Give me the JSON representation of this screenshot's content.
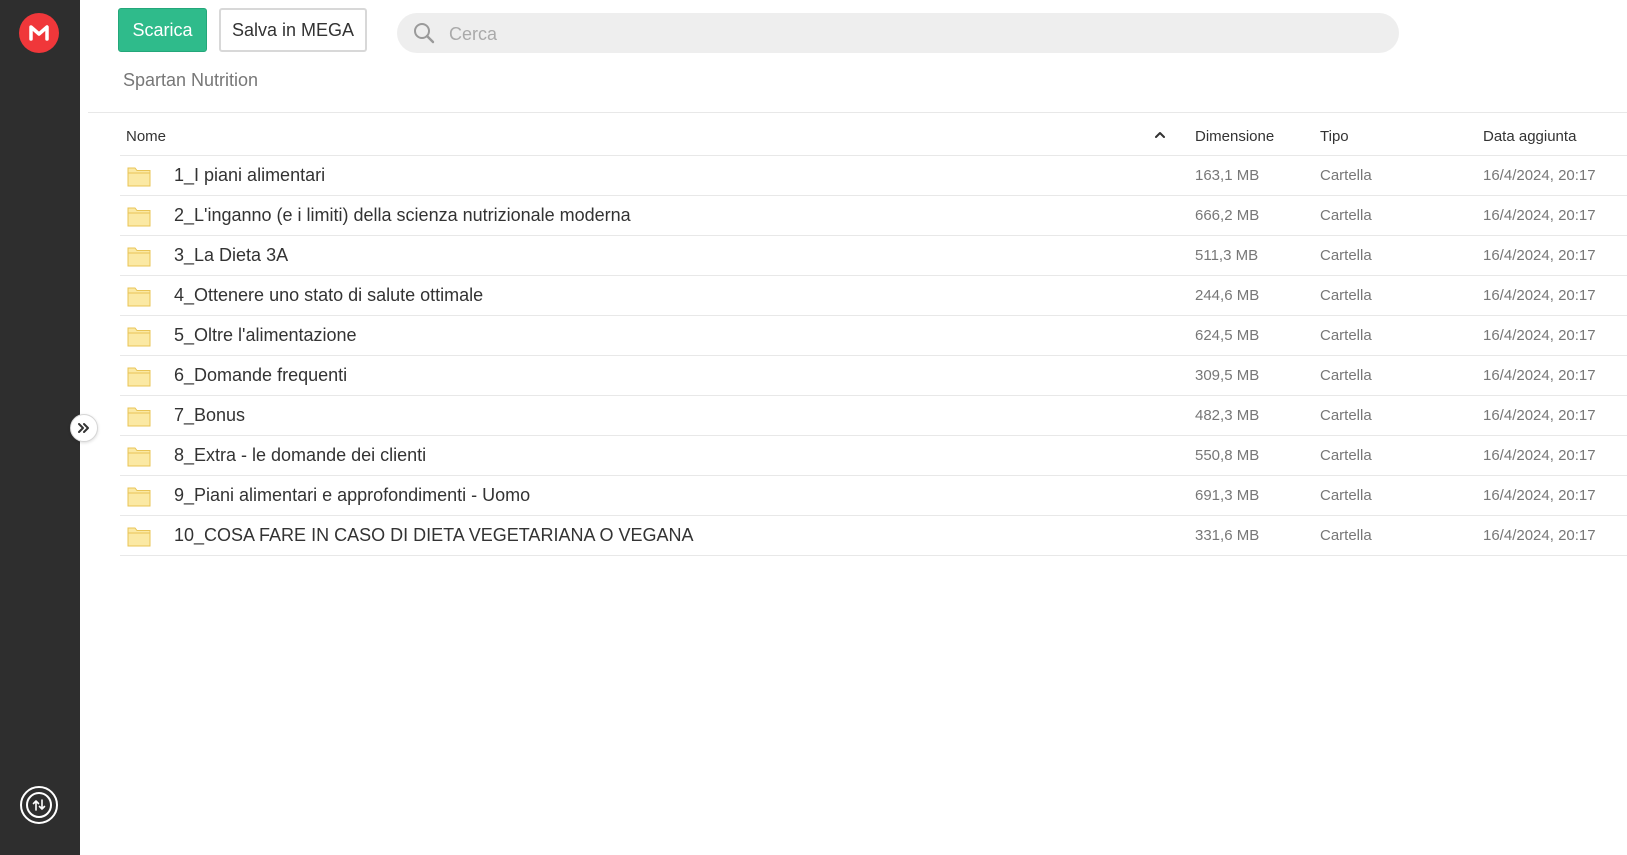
{
  "app": {
    "brand_color": "#f0373a",
    "accent_color": "#2fbb8b"
  },
  "toolbar": {
    "download_label": "Scarica",
    "save_label": "Salva in MEGA"
  },
  "search": {
    "placeholder": "Cerca",
    "value": ""
  },
  "breadcrumb": {
    "current": "Spartan Nutrition"
  },
  "table": {
    "headers": {
      "name": "Nome",
      "size": "Dimensione",
      "type": "Tipo",
      "date": "Data aggiunta"
    },
    "sort": {
      "column": "name",
      "direction": "ascending"
    },
    "rows": [
      {
        "name": "1_I piani alimentari",
        "size": "163,1 MB",
        "type": "Cartella",
        "date": "16/4/2024, 20:17",
        "icon": "folder-icon"
      },
      {
        "name": "2_L'inganno (e i limiti) della scienza nutrizionale moderna",
        "size": "666,2 MB",
        "type": "Cartella",
        "date": "16/4/2024, 20:17",
        "icon": "folder-icon"
      },
      {
        "name": "3_La Dieta 3A",
        "size": "511,3 MB",
        "type": "Cartella",
        "date": "16/4/2024, 20:17",
        "icon": "folder-icon"
      },
      {
        "name": "4_Ottenere uno stato di salute ottimale",
        "size": "244,6 MB",
        "type": "Cartella",
        "date": "16/4/2024, 20:17",
        "icon": "folder-icon"
      },
      {
        "name": "5_Oltre l'alimentazione",
        "size": "624,5 MB",
        "type": "Cartella",
        "date": "16/4/2024, 20:17",
        "icon": "folder-icon"
      },
      {
        "name": "6_Domande frequenti",
        "size": "309,5 MB",
        "type": "Cartella",
        "date": "16/4/2024, 20:17",
        "icon": "folder-icon"
      },
      {
        "name": "7_Bonus",
        "size": "482,3 MB",
        "type": "Cartella",
        "date": "16/4/2024, 20:17",
        "icon": "folder-icon"
      },
      {
        "name": "8_Extra - le domande dei clienti",
        "size": "550,8 MB",
        "type": "Cartella",
        "date": "16/4/2024, 20:17",
        "icon": "folder-icon"
      },
      {
        "name": "9_Piani alimentari e approfondimenti - Uomo",
        "size": "691,3 MB",
        "type": "Cartella",
        "date": "16/4/2024, 20:17",
        "icon": "folder-icon"
      },
      {
        "name": "10_COSA FARE IN CASO DI DIETA VEGETARIANA O VEGANA",
        "size": "331,6 MB",
        "type": "Cartella",
        "date": "16/4/2024, 20:17",
        "icon": "folder-icon"
      }
    ]
  }
}
